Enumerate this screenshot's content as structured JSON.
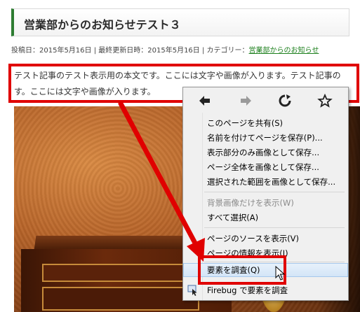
{
  "post": {
    "title": "営業部からのお知らせテスト３",
    "meta_prefix": "投稿日：2015年5月16日 | 最終更新日時：2015年5月16日 | カテゴリー：",
    "category_link": "営業部からのお知らせ",
    "body_line1": "テスト記事のテスト表示用の本文です。ここには文字や画像が入ります。テスト記事の",
    "body_line2": "す。ここには文字や画像が入ります。"
  },
  "context_menu": {
    "nav_icons": [
      "back-arrow-icon",
      "forward-arrow-icon",
      "reload-icon",
      "bookmark-star-icon"
    ],
    "items": [
      {
        "label": "このページを共有(S)",
        "disabled": false
      },
      {
        "label": "名前を付けてページを保存(P)...",
        "disabled": false
      },
      {
        "label": "表示部分のみ画像として保存...",
        "disabled": false
      },
      {
        "label": "ページ全体を画像として保存...",
        "disabled": false
      },
      {
        "label": "選択された範囲を画像として保存...",
        "disabled": false
      },
      {
        "label": "背景画像だけを表示(W)",
        "disabled": true
      },
      {
        "label": "すべて選択(A)",
        "disabled": false
      },
      {
        "label": "ページのソースを表示(V)",
        "disabled": false
      },
      {
        "label": "ページの情報を表示(I)",
        "disabled": false
      },
      {
        "label": "要素を調査(Q)",
        "disabled": false,
        "highlighted": true
      },
      {
        "label": "Firebug で要素を調査",
        "disabled": false
      }
    ]
  },
  "colors": {
    "annotation_red": "#e00000",
    "title_accent": "#2e7d32",
    "link_green": "#1b7f1b"
  }
}
